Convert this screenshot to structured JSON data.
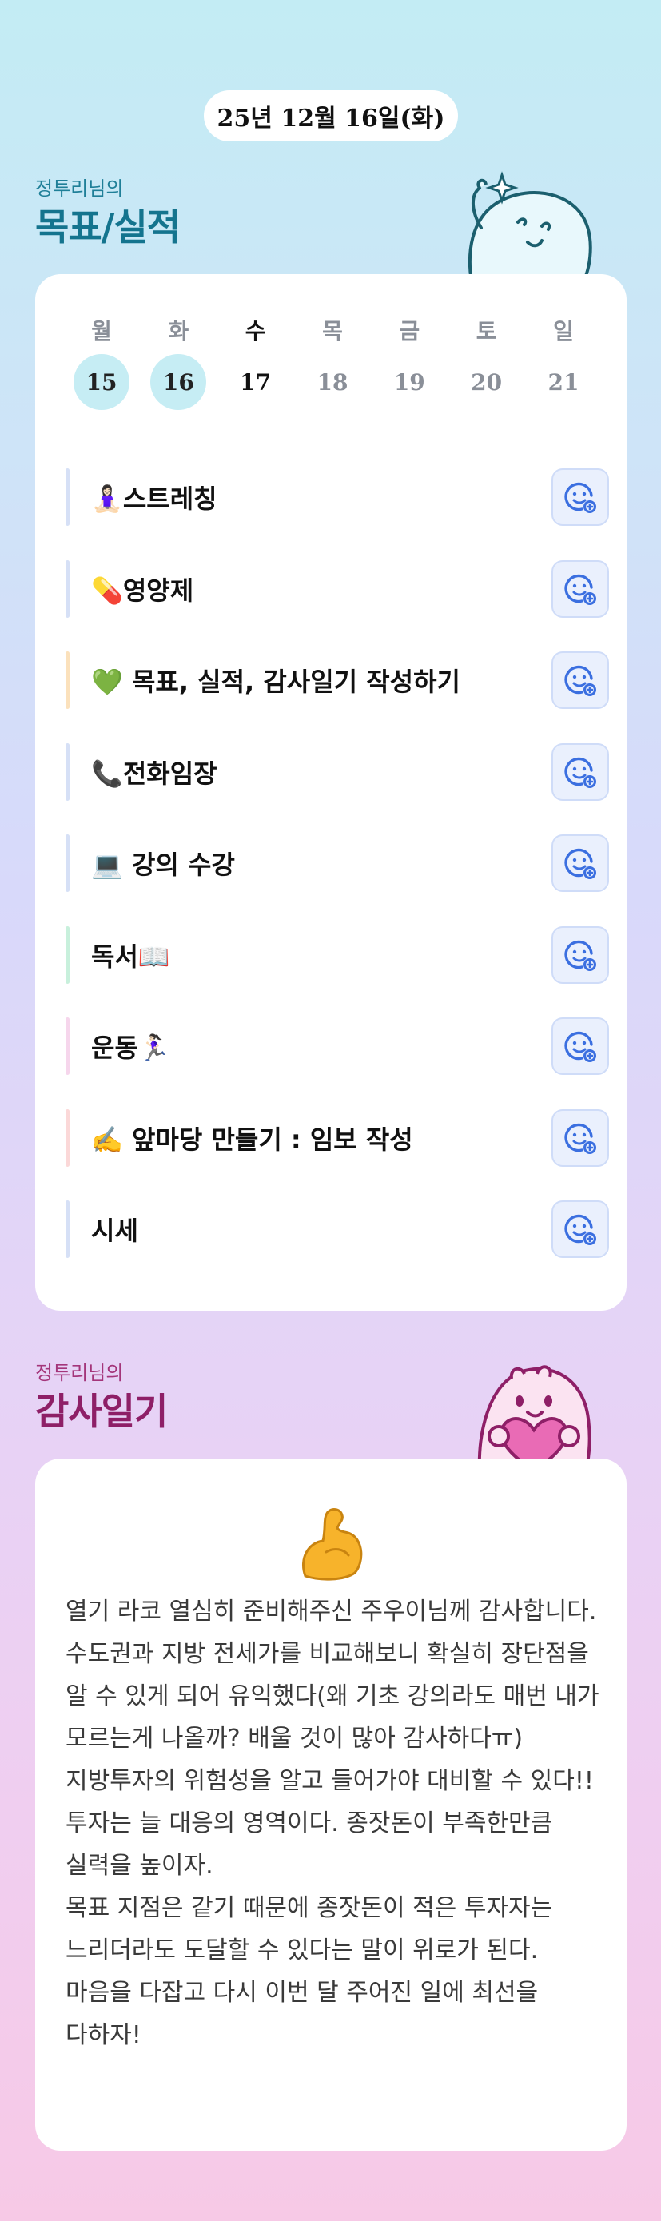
{
  "header": {
    "date": "25년 12월 16일(화)"
  },
  "goals_section": {
    "subtitle": "정투리님의",
    "title": "목표/실적"
  },
  "week": {
    "days": [
      {
        "label": "월",
        "num": "15",
        "done": true,
        "today": false
      },
      {
        "label": "화",
        "num": "16",
        "done": true,
        "today": false
      },
      {
        "label": "수",
        "num": "17",
        "done": false,
        "today": true
      },
      {
        "label": "목",
        "num": "18",
        "done": false,
        "today": false
      },
      {
        "label": "금",
        "num": "19",
        "done": false,
        "today": false
      },
      {
        "label": "토",
        "num": "20",
        "done": false,
        "today": false
      },
      {
        "label": "일",
        "num": "21",
        "done": false,
        "today": false
      }
    ]
  },
  "goals": [
    {
      "label": "🧘🏻‍♀️스트레칭",
      "bar_color": "#d6e0f6"
    },
    {
      "label": "💊영양제",
      "bar_color": "#d6e0f6"
    },
    {
      "label": "💚 목표, 실적, 감사일기 작성하기",
      "bar_color": "#fbe1bc"
    },
    {
      "label": "📞전화임장",
      "bar_color": "#d6e0f6"
    },
    {
      "label": "💻 강의 수강",
      "bar_color": "#d6e0f6"
    },
    {
      "label": "독서📖",
      "bar_color": "#c8f0dc"
    },
    {
      "label": "운동🏃🏻‍♀️",
      "bar_color": "#f6d6ec"
    },
    {
      "label": "✍️ 앞마당 만들기 : 임보 작성",
      "bar_color": "#fbd8d8"
    },
    {
      "label": "시세",
      "bar_color": "#d6e0f6"
    }
  ],
  "goal_button_icon": "smiley-check-icon",
  "thanks_section": {
    "subtitle": "정투리님의",
    "title": "감사일기",
    "icon": "flexed-bicep-icon",
    "text": "열기 라코 열심히 준비해주신 주우이님께 감사합니다. 수도권과 지방 전세가를 비교해보니 확실히 장단점을 알 수 있게 되어 유익했다(왜 기초 강의라도 매번 내가 모르는게 나올까? 배울 것이 많아 감사하다ㅠ) 지방투자의 위험성을 알고 들어가야 대비할 수 있다!!\n투자는 늘 대응의 영역이다. 종잣돈이 부족한만큼 실력을 높이자.\n목표 지점은 같기 때문에 종잣돈이 적은 투자자는 느리더라도 도달할 수 있다는 말이 위로가 된다.\n마음을 다잡고 다시 이번 달 주어진 일에 최선을 다하자!"
  },
  "colors": {
    "goals_title": "#14748e",
    "thanks_title": "#8e1f67",
    "done_circle": "#c6edf4",
    "button_bg": "#eaf0fd",
    "button_icon": "#3b6fe0"
  }
}
